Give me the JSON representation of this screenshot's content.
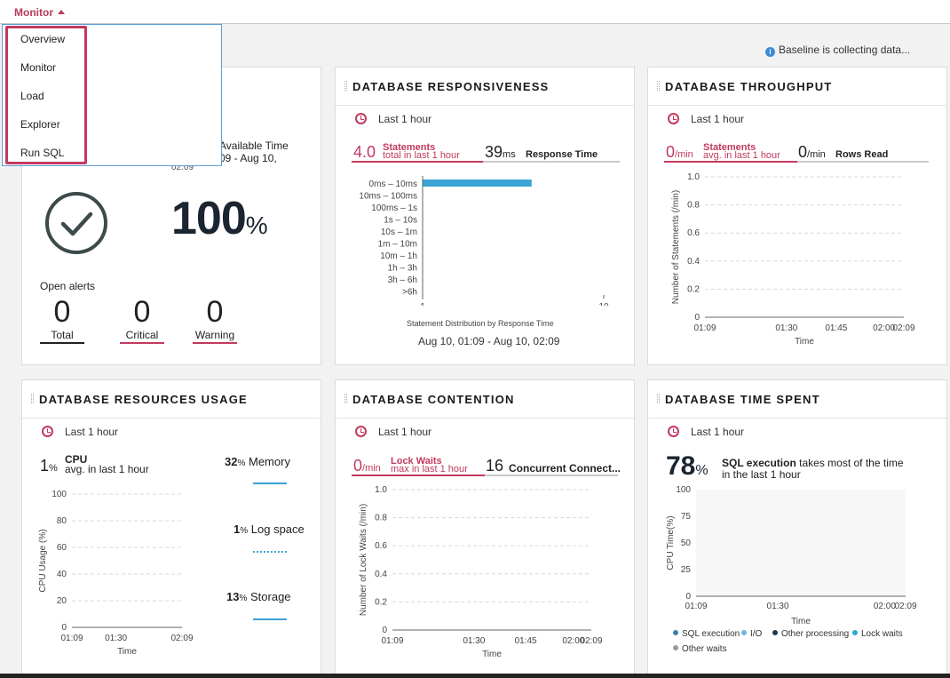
{
  "topbar": {
    "title": "Monitor"
  },
  "menu": {
    "items": [
      "Overview",
      "Monitor",
      "Load",
      "Explorer",
      "Run SQL"
    ]
  },
  "baseline": {
    "text": "Baseline is collecting data..."
  },
  "availability": {
    "header_title": "Available Time",
    "range_partial": "09 - Aug 10,",
    "range_end": "02:09",
    "percent": "100",
    "percent_sign": "%",
    "open_alerts_label": "Open alerts",
    "alerts": [
      {
        "count": "0",
        "label": "Total",
        "color": "#222222"
      },
      {
        "count": "0",
        "label": "Critical",
        "color": "#c23a5e"
      },
      {
        "count": "0",
        "label": "Warning",
        "color": "#c23a5e"
      }
    ]
  },
  "responsiveness": {
    "title": "DATABASE RESPONSIVENESS",
    "range": "Last 1 hour",
    "statements_value": "4.0",
    "statements_label": "Statements",
    "statements_sub": "total in last 1 hour",
    "response_value": "39",
    "response_unit": "ms",
    "response_label": "Response Time",
    "chart_caption": "Statement Distribution by Response Time",
    "date_range": "Aug 10, 01:09 - Aug 10, 02:09"
  },
  "throughput": {
    "title": "DATABASE THROUGHPUT",
    "range": "Last 1 hour",
    "statements_value": "0",
    "statements_unit": "/min",
    "statements_label": "Statements",
    "statements_sub": "avg. in last 1 hour",
    "rows_value": "0",
    "rows_unit": "/min",
    "rows_label": "Rows Read"
  },
  "resources": {
    "title": "DATABASE RESOURCES USAGE",
    "range": "Last 1 hour",
    "cpu_value": "1",
    "cpu_unit": "%",
    "cpu_label": "CPU",
    "cpu_sub": "avg. in last 1 hour",
    "memory_value": "32",
    "memory_label": "Memory",
    "logspace_value": "1",
    "logspace_label": "Log space",
    "storage_value": "13",
    "storage_label": "Storage",
    "pct": "%"
  },
  "contention": {
    "title": "DATABASE CONTENTION",
    "range": "Last 1 hour",
    "lockwaits_value": "0",
    "lockwaits_unit": "/min",
    "lockwaits_label": "Lock Waits",
    "lockwaits_sub": "max in last 1 hour",
    "concurrent_value": "16",
    "concurrent_label": "Concurrent Connect..."
  },
  "timespent": {
    "title": "DATABASE TIME SPENT",
    "range": "Last 1 hour",
    "percent": "78",
    "percent_sign": "%",
    "headline_bold": "SQL execution",
    "headline_rest": " takes most of the time",
    "headline_line2": "in the last 1 hour",
    "legend": [
      {
        "label": "SQL execution",
        "color": "#3a7fb0"
      },
      {
        "label": "I/O",
        "color": "#6fb8de"
      },
      {
        "label": "Other processing",
        "color": "#1f3b4d"
      },
      {
        "label": "Lock waits",
        "color": "#2aa8d8"
      },
      {
        "label": "Other waits",
        "color": "#9a9a9a"
      }
    ]
  },
  "chart_data": [
    {
      "id": "response_distribution",
      "type": "bar",
      "orientation": "horizontal",
      "categories": [
        "0ms – 10ms",
        "10ms – 100ms",
        "100ms – 1s",
        "1s – 10s",
        "10s – 1m",
        "1m – 10m",
        "10m – 1h",
        "1h – 3h",
        "3h – 6h",
        ">6h"
      ],
      "values": [
        4,
        0,
        0,
        0,
        0,
        0,
        0,
        0,
        0,
        0
      ],
      "xscale": "log",
      "xlim": [
        1,
        10
      ],
      "xticks": [
        "1",
        "10"
      ],
      "color": "#3ba4d4",
      "title": "Statement Distribution by Response Time"
    },
    {
      "id": "throughput_line",
      "type": "line",
      "x": [
        "01:09",
        "01:30",
        "01:45",
        "02:00",
        "02:09"
      ],
      "series": [],
      "ylim": [
        0,
        1.0
      ],
      "yticks": [
        "0",
        "0.2",
        "0.4",
        "0.6",
        "0.8",
        "1.0"
      ],
      "xlabel": "Time",
      "ylabel": "Number of Statements (/min)",
      "grid": true
    },
    {
      "id": "cpu_usage",
      "type": "line",
      "x": [
        "01:09",
        "01:30",
        "02:09"
      ],
      "series": [],
      "ylim": [
        0,
        100
      ],
      "yticks": [
        "0",
        "20",
        "40",
        "60",
        "80",
        "100"
      ],
      "xlabel": "Time",
      "ylabel": "CPU Usage (%)",
      "grid": true
    },
    {
      "id": "lock_waits",
      "type": "line",
      "x": [
        "01:09",
        "01:30",
        "01:45",
        "02:00",
        "02:09"
      ],
      "series": [],
      "ylim": [
        0,
        1.0
      ],
      "yticks": [
        "0",
        "0.2",
        "0.4",
        "0.6",
        "0.8",
        "1.0"
      ],
      "xlabel": "Time",
      "ylabel": "Number of Lock Waits (/min)",
      "grid": true
    },
    {
      "id": "time_spent",
      "type": "area",
      "x": [
        "01:09",
        "01:30",
        "02:00",
        "02:09"
      ],
      "series": [],
      "ylim": [
        0,
        100
      ],
      "yticks": [
        "0",
        "25",
        "50",
        "75",
        "100"
      ],
      "xlabel": "Time",
      "ylabel": "CPU Time(%)",
      "grid": false
    }
  ]
}
